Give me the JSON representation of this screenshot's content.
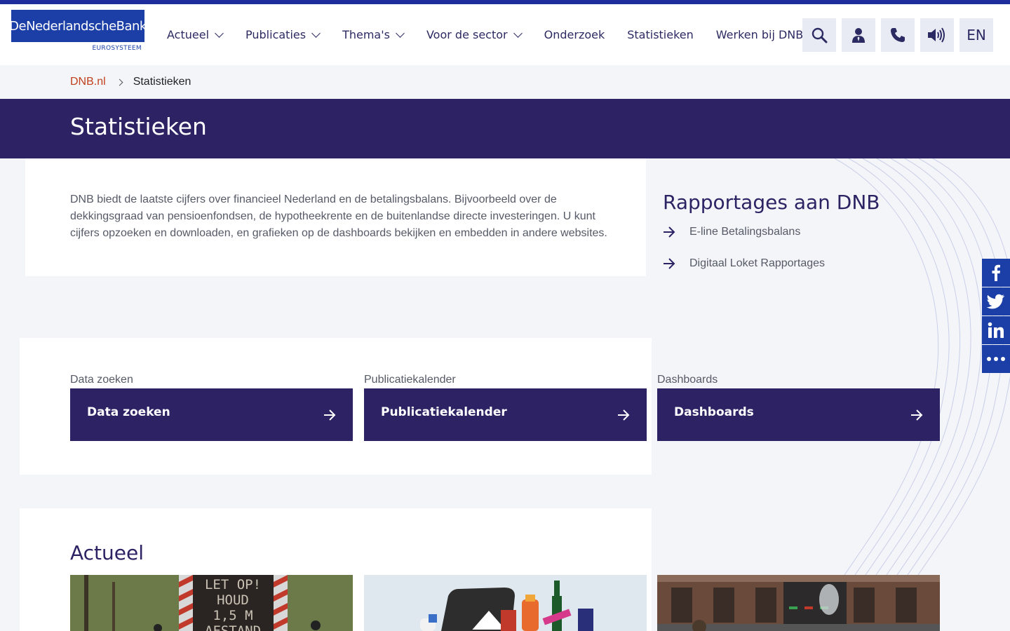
{
  "logo": {
    "name": "DeNederlandscheBank",
    "sub": "EUROSYSTEEM"
  },
  "nav": [
    {
      "label": "Actueel",
      "dropdown": true
    },
    {
      "label": "Publicaties",
      "dropdown": true
    },
    {
      "label": "Thema's",
      "dropdown": true
    },
    {
      "label": "Voor de sector",
      "dropdown": true
    },
    {
      "label": "Onderzoek",
      "dropdown": false
    },
    {
      "label": "Statistieken",
      "dropdown": false
    },
    {
      "label": "Werken bij DNB",
      "dropdown": false
    }
  ],
  "tools": {
    "search_icon": "search-icon",
    "login_icon": "user-icon",
    "contact_icon": "phone-icon",
    "readspeaker_icon": "speaker-icon",
    "language": "EN"
  },
  "breadcrumb": {
    "home": "DNB.nl",
    "current": "Statistieken"
  },
  "page": {
    "title": "Statistieken"
  },
  "intro": {
    "text": "DNB biedt de laatste cijfers over financieel Nederland en de betalingsbalans. Bijvoorbeeld over de dekkingsgraad van pensioenfondsen, de hypotheekrente en de buitenlandse directe investeringen. U kunt cijfers opzoeken en downloaden, en grafieken op de dashboards bekijken en embedden in andere websites."
  },
  "reports": {
    "title": "Rapportages aan DNB",
    "links": [
      "E-line Betalingsbalans",
      "Digitaal Loket Rapportages"
    ]
  },
  "share": [
    "facebook-icon",
    "twitter-icon",
    "linkedin-icon",
    "more-icon"
  ],
  "tiles": [
    {
      "alt": "Data zoeken",
      "label": "Data zoeken"
    },
    {
      "alt": "Publicatiekalender",
      "label": "Publicatiekalender"
    },
    {
      "alt": "Dashboards",
      "label": "Dashboards"
    }
  ],
  "news": {
    "title": "Actueel",
    "sign_text": [
      "LET OP!",
      "HOUD",
      "1,5 M",
      "AFSTAND"
    ]
  },
  "colors": {
    "brand": "#1b3fa6",
    "banner": "#2c2264",
    "breadcrumb_link": "#c0411b"
  }
}
